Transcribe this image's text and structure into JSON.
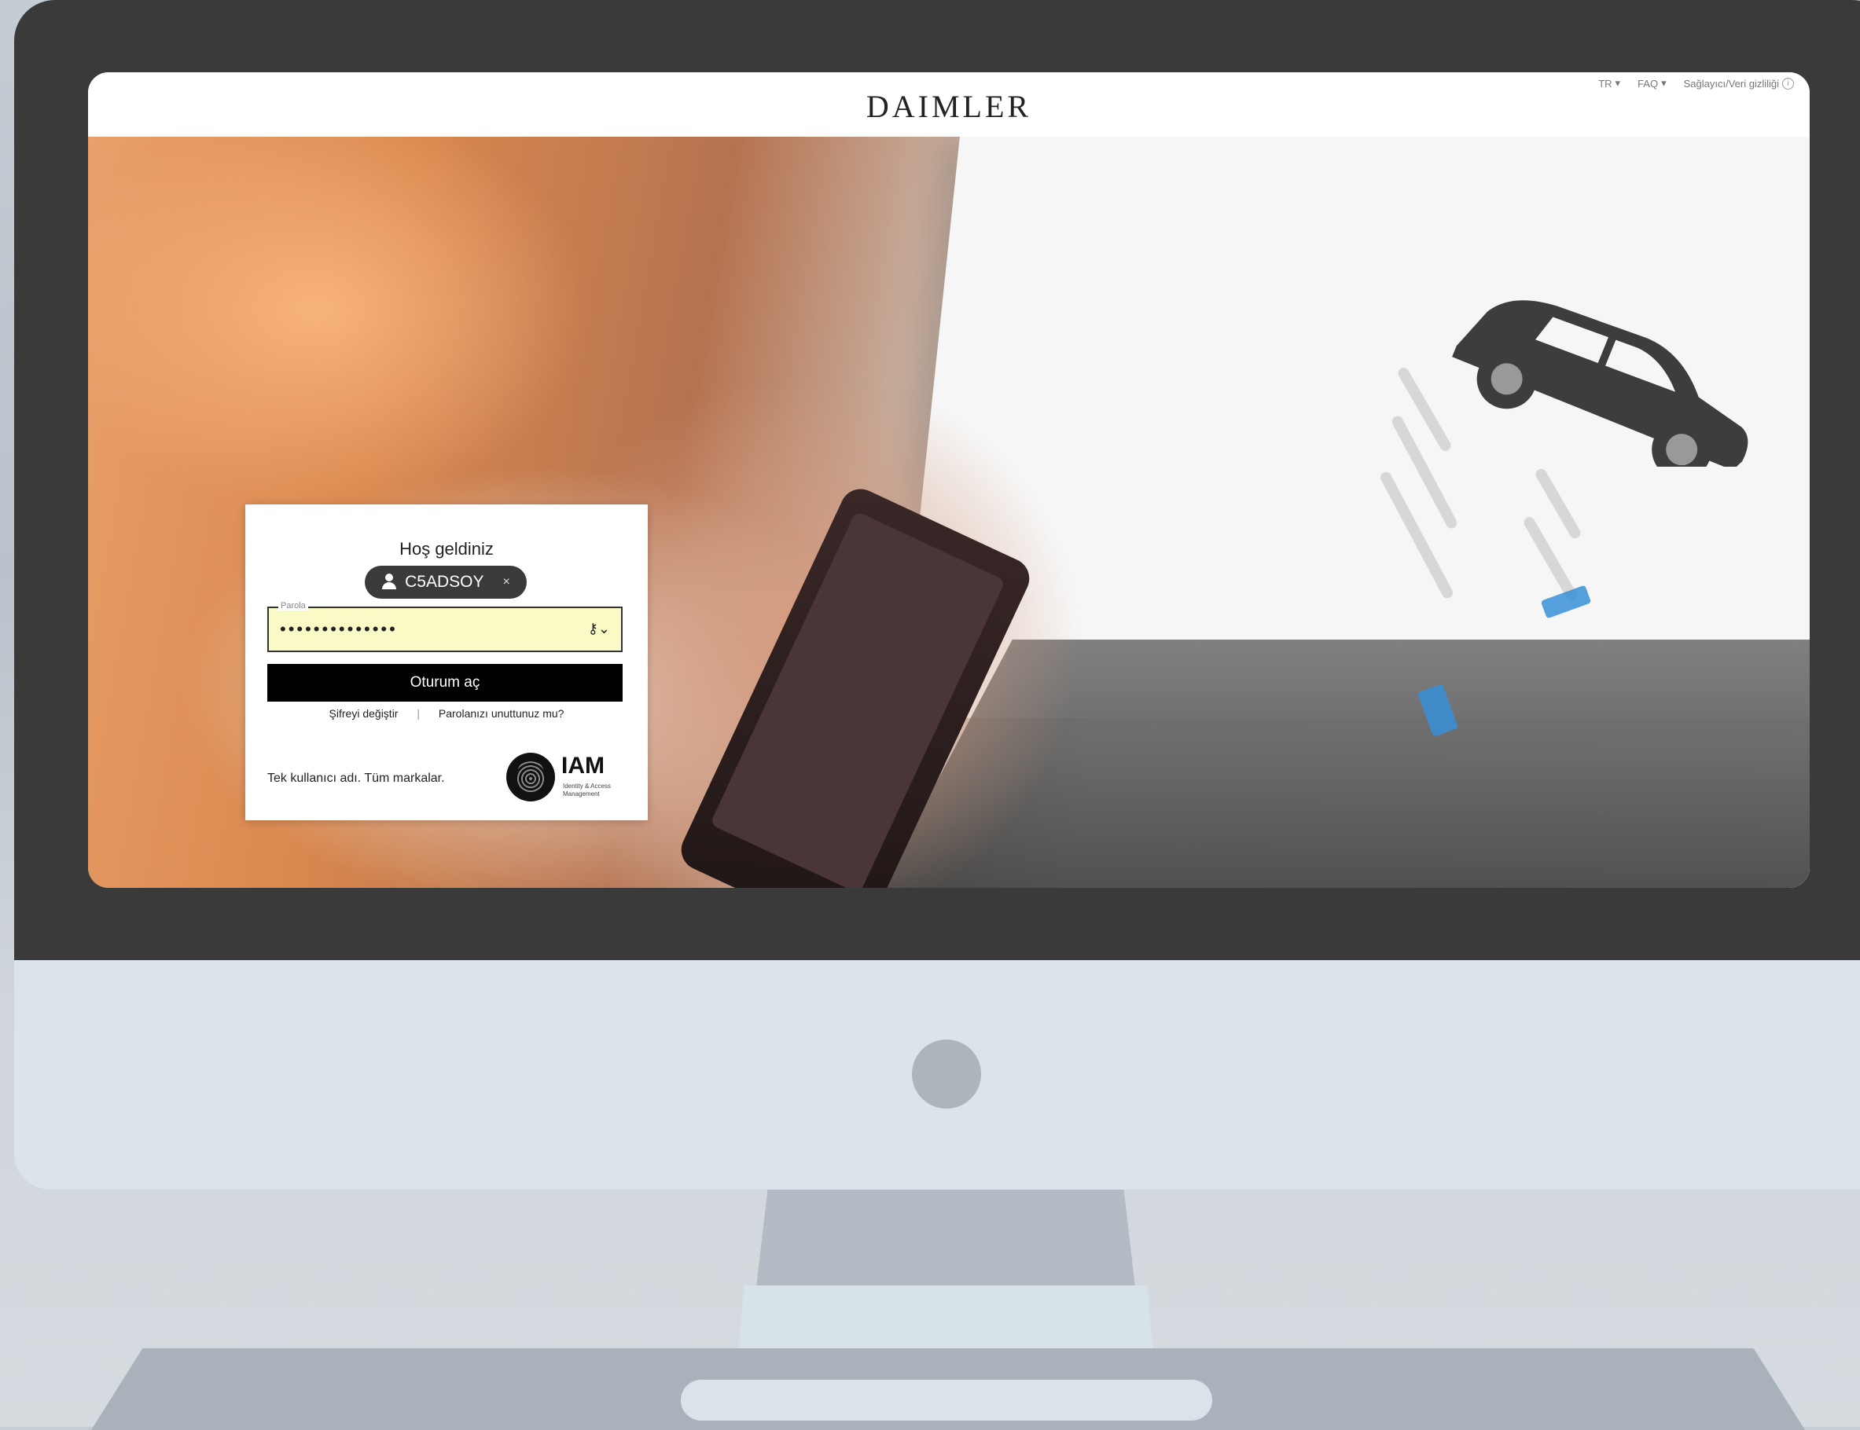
{
  "header": {
    "brand": "DAIMLER",
    "nav": {
      "language": "TR",
      "faq": "FAQ",
      "privacy": "Sağlayıcı/Veri gizliliği"
    }
  },
  "login": {
    "welcome": "Hoş geldiniz",
    "username": "C5ADSOY",
    "password_label": "Parola",
    "password_value": "••••••••••••••",
    "submit": "Oturum aç",
    "change_password": "Şifreyi değiştir",
    "forgot_password": "Parolanızı unuttunuz mu?",
    "tagline": "Tek kullanıcı adı. Tüm markalar.",
    "iam_logo": "IAM",
    "iam_subtitle": "Identity & Access Management"
  },
  "colors": {
    "bezel": "#3a3a3a",
    "button": "#000000",
    "password_bg": "#fafac6",
    "chip": "#3a3a3a"
  }
}
